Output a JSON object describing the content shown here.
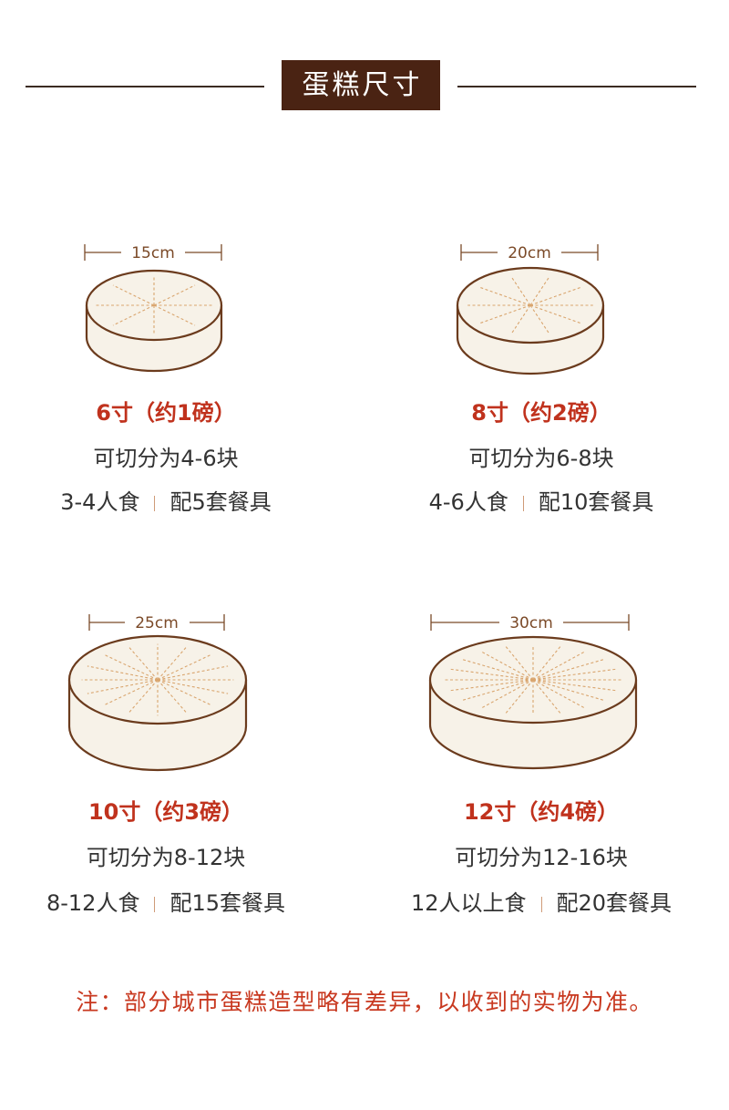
{
  "header": {
    "title": "蛋糕尺寸"
  },
  "colors": {
    "header_bg": "#4a2313",
    "accent_red": "#c0321d",
    "note_red": "#c8381f",
    "cake_outline": "#6b3b1d",
    "cake_fill": "#f7f2e8",
    "cut_line": "#d9a56e",
    "dimension": "#7b4a28"
  },
  "cakes": [
    {
      "diameter": "15cm",
      "size": "6寸（约1磅）",
      "portions": "可切分为4-6块",
      "servings": "3-4人食",
      "cutlery": "配5套餐具",
      "cut_lines": 8
    },
    {
      "diameter": "20cm",
      "size": "8寸（约2磅）",
      "portions": "可切分为6-8块",
      "servings": "4-6人食",
      "cutlery": "配10套餐具",
      "cut_lines": 10
    },
    {
      "diameter": "25cm",
      "size": "10寸（约3磅）",
      "portions": "可切分为8-12块",
      "servings": "8-12人食",
      "cutlery": "配15套餐具",
      "cut_lines": 16
    },
    {
      "diameter": "30cm",
      "size": "12寸（约4磅）",
      "portions": "可切分为12-16块",
      "servings": "12人以上食",
      "cutlery": "配20套餐具",
      "cut_lines": 20
    }
  ],
  "note": "注：部分城市蛋糕造型略有差异，以收到的实物为准。"
}
